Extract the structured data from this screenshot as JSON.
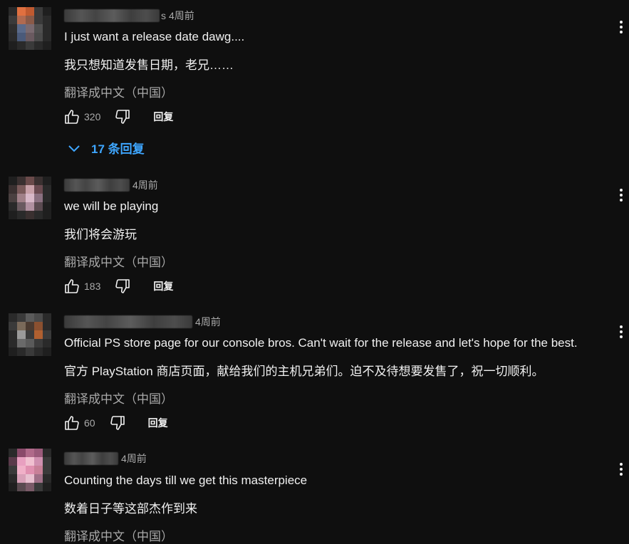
{
  "comments": [
    {
      "author_tail": "s",
      "time": "4周前",
      "text": "I just want a release date dawg....",
      "translation_text": "我只想知道发售日期，老兄……",
      "translate_label": "翻译成中文（中国）",
      "likes": "320",
      "reply_label": "回复",
      "replies_label": "17 条回复",
      "avatar": [
        "#2a2a2a",
        "#e07040",
        "#c05a30",
        "#3a3a3a",
        "#1f1f1f",
        "#3a3a3a",
        "#b06a50",
        "#8a5a48",
        "#3a3a3a",
        "#2a2a2a",
        "#2e2e2e",
        "#5a6a8a",
        "#7a6a70",
        "#505050",
        "#2a2a2a",
        "#2a2a2a",
        "#4a5a7a",
        "#6a5a60",
        "#4a4a4a",
        "#2a2a2a",
        "#1f1f1f",
        "#2a2a2a",
        "#3a3a3a",
        "#2a2a2a",
        "#1f1f1f"
      ]
    },
    {
      "author_tail": "",
      "time": "4周前",
      "text": "we will be playing",
      "translation_text": "我们将会游玩",
      "translate_label": "翻译成中文（中国）",
      "likes": "183",
      "reply_label": "回复",
      "avatar": [
        "#1f1f1f",
        "#3a3030",
        "#6a4a4a",
        "#3a3030",
        "#1f1f1f",
        "#3a3030",
        "#7a5a5a",
        "#c8a0a8",
        "#6a4a50",
        "#2a2a2a",
        "#4a4040",
        "#a08088",
        "#d8b8c8",
        "#8a7080",
        "#2a2a2a",
        "#2a2a2a",
        "#6a5a60",
        "#b090a0",
        "#5a4a50",
        "#1f1f1f",
        "#1f1f1f",
        "#2a2a2a",
        "#3a3030",
        "#2a2a2a",
        "#1f1f1f"
      ]
    },
    {
      "author_tail": "",
      "time": "4周前",
      "text": "Official PS store page for our console bros. Can't wait for the release and let's hope for the best.",
      "translation_text": "官方 PlayStation 商店页面，献给我们的主机兄弟们。迫不及待想要发售了，祝一切顺利。",
      "translate_label": "翻译成中文（中国）",
      "likes": "60",
      "reply_label": "回复",
      "avatar": [
        "#2a2a2a",
        "#3a3a3a",
        "#5a5a5a",
        "#4a4a4a",
        "#2a2a2a",
        "#3a3a3a",
        "#7a6a5a",
        "#4a3a30",
        "#8a5030",
        "#2a2a2a",
        "#2a2a2a",
        "#9a9a9a",
        "#3a3a3a",
        "#b06030",
        "#3a3a3a",
        "#2a2a2a",
        "#6a6a6a",
        "#5a5a5a",
        "#3a3a3a",
        "#2a2a2a",
        "#1f1f1f",
        "#2a2a2a",
        "#3a3a3a",
        "#2a2a2a",
        "#1f1f1f"
      ]
    },
    {
      "author_tail": "",
      "time": "4周前",
      "text": "Counting the days till we get this masterpiece",
      "translation_text": "数着日子等这部杰作到来",
      "translate_label": "翻译成中文（中国）",
      "avatar": [
        "#2a2a2a",
        "#8a4a6a",
        "#b06a8a",
        "#9a5a7a",
        "#2a2a2a",
        "#5a3a4a",
        "#e8a0c0",
        "#f0c0d0",
        "#d090b0",
        "#3a3a3a",
        "#3a3a3a",
        "#f0b0c8",
        "#e090b0",
        "#c88098",
        "#3a3a3a",
        "#2a2a2a",
        "#d8a0b8",
        "#e8c0d0",
        "#a07088",
        "#2a2a2a",
        "#1f1f1f",
        "#5a4a50",
        "#7a5a68",
        "#3a3a3a",
        "#1f1f1f"
      ]
    }
  ],
  "icons": {
    "like": "thumbs-up-icon",
    "dislike": "thumbs-down-icon",
    "more": "more-vert-icon",
    "expand": "chevron-down-icon"
  },
  "colors": {
    "background": "#0f0f0f",
    "text": "#f1f1f1",
    "secondary": "#aaaaaa",
    "link": "#3ea6ff"
  }
}
